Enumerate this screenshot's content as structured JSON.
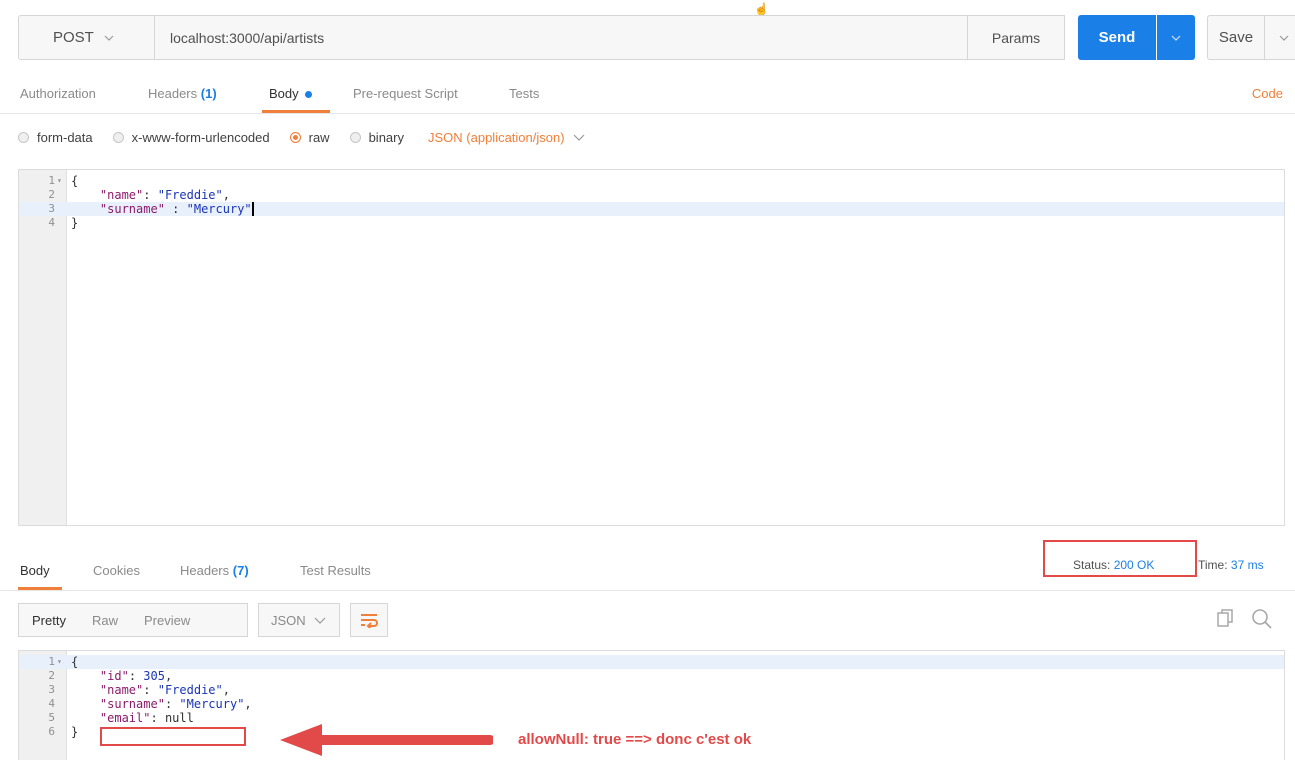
{
  "request": {
    "method": "POST",
    "url": "localhost:3000/api/artists",
    "params_label": "Params",
    "send_label": "Send",
    "save_label": "Save"
  },
  "request_tabs": {
    "authorization": "Authorization",
    "headers": "Headers",
    "headers_count": "(1)",
    "body": "Body",
    "pre_request": "Pre-request Script",
    "tests": "Tests",
    "code": "Code"
  },
  "body_options": {
    "form_data": "form-data",
    "urlencoded": "x-www-form-urlencoded",
    "raw": "raw",
    "binary": "binary",
    "content_type": "JSON (application/json)"
  },
  "request_body": {
    "line_numbers": [
      "1",
      "2",
      "3",
      "4"
    ],
    "open": "{",
    "name_key": "\"name\"",
    "name_value": "\"Freddie\"",
    "surname_key": "\"surname\"",
    "surname_value": "\"Mercury\"",
    "close": "}"
  },
  "response_tabs": {
    "body": "Body",
    "cookies": "Cookies",
    "headers": "Headers",
    "headers_count": "(7)",
    "test_results": "Test Results",
    "status_label": "Status:",
    "status_value": "200 OK",
    "time_label": "Time:",
    "time_value": "37 ms"
  },
  "response_toolbar": {
    "pretty": "Pretty",
    "raw": "Raw",
    "preview": "Preview",
    "format": "JSON"
  },
  "response_body": {
    "line_numbers": [
      "1",
      "2",
      "3",
      "4",
      "5",
      "6"
    ],
    "open": "{",
    "id_key": "\"id\"",
    "id_value": "305",
    "name_key": "\"name\"",
    "name_value": "\"Freddie\"",
    "surname_key": "\"surname\"",
    "surname_value": "\"Mercury\"",
    "email_key": "\"email\"",
    "email_value": "null",
    "close": "}"
  },
  "annotation": {
    "text": "allowNull: true ==> donc c'est ok",
    "color": "#e24a4a"
  },
  "colors": {
    "accent_blue": "#1a7fe6",
    "accent_orange": "#f07f3a"
  }
}
